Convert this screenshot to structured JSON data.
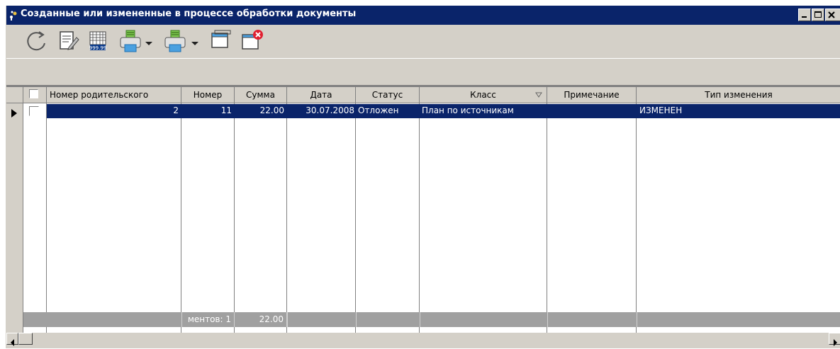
{
  "window": {
    "title": "Созданные или измененные в процессе обработки документы"
  },
  "toolbar": {
    "buttons": [
      {
        "icon": "refresh-icon"
      },
      {
        "icon": "edit-document-icon"
      },
      {
        "icon": "calculator-grid-icon"
      },
      {
        "icon": "print-icon"
      },
      {
        "icon": "print-preview-icon"
      },
      {
        "icon": "window-icon"
      },
      {
        "icon": "close-window-icon"
      }
    ]
  },
  "grid": {
    "columns": [
      "Номер родительского",
      "Номер",
      "Сумма",
      "Дата",
      "Статус",
      "Класс",
      "Примечание",
      "Тип изменения"
    ],
    "rows": [
      {
        "parent_number": "2",
        "number": "11",
        "sum": "22.00",
        "date": "30.07.2008",
        "status": "Отложен",
        "class": "План по источникам",
        "note": "",
        "change_type": "ИЗМЕНЕН"
      }
    ],
    "footer": {
      "count_text": "ментов: 1",
      "sum_total": "22.00"
    }
  },
  "colors": {
    "title_bar": "#0a246a",
    "selection": "#0a246a",
    "window_face": "#d4d0c8",
    "footer_bg": "#a0a0a0"
  }
}
